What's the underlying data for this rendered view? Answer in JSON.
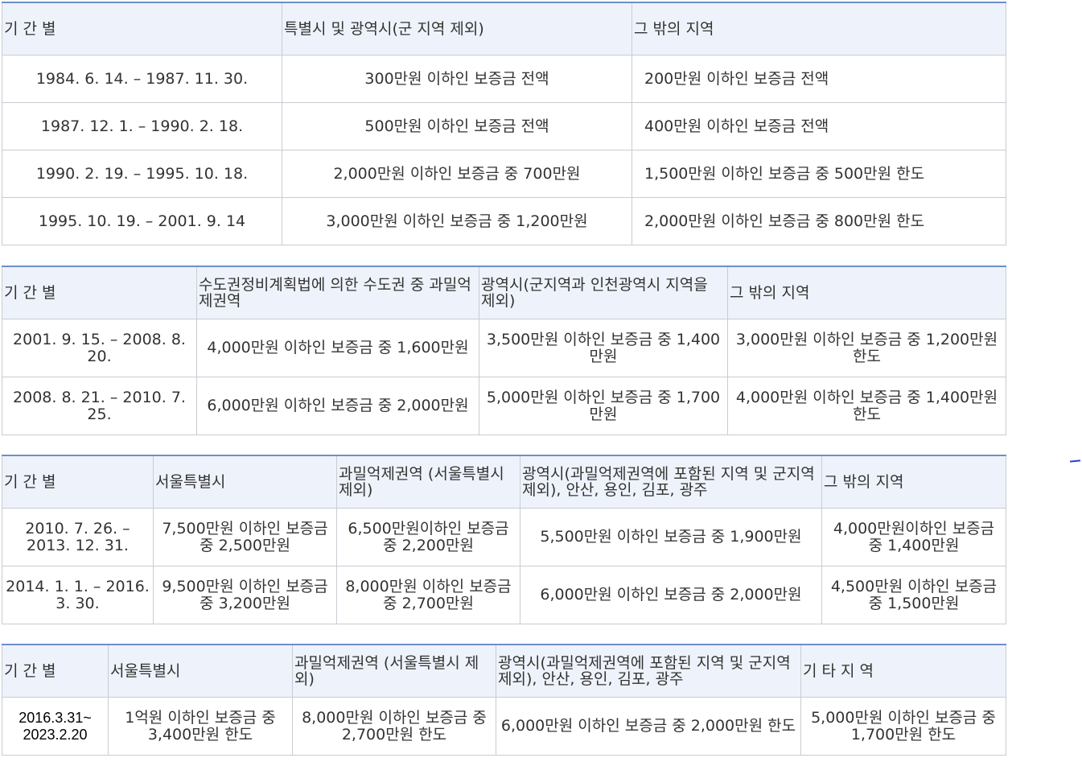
{
  "tables": [
    {
      "headers": [
        "기 간 별",
        "특별시 및 광역시(군 지역 제외)",
        "그 밖의 지역"
      ],
      "rows": [
        [
          "1984. 6. 14. – 1987. 11. 30.",
          "300만원 이하인 보증금 전액",
          "200만원 이하인 보증금 전액"
        ],
        [
          "1987. 12. 1. – 1990. 2. 18.",
          "500만원 이하인 보증금 전액",
          "400만원 이하인 보증금 전액"
        ],
        [
          "1990. 2. 19. – 1995. 10. 18.",
          "2,000만원 이하인 보증금 중 700만원",
          "1,500만원 이하인 보증금 중 500만원 한도"
        ],
        [
          "1995. 10. 19. – 2001. 9. 14",
          "3,000만원 이하인 보증금 중 1,200만원",
          "2,000만원 이하인 보증금 중 800만원 한도"
        ]
      ]
    },
    {
      "headers": [
        "기 간 별",
        "수도권정비계획법에 의한 수도권 중 과밀억제권역",
        "광역시(군지역과 인천광역시 지역을 제외)",
        "그 밖의 지역"
      ],
      "rows": [
        [
          "2001. 9. 15. – 2008. 8. 20.",
          "4,000만원 이하인 보증금 중 1,600만원",
          "3,500만원 이하인 보증금 중 1,400만원",
          "3,000만원 이하인 보증금 중 1,200만원 한도"
        ],
        [
          "2008. 8. 21. – 2010. 7. 25.",
          "6,000만원 이하인 보증금 중 2,000만원",
          "5,000만원 이하인 보증금 중 1,700만원",
          "4,000만원 이하인 보증금 중 1,400만원 한도"
        ]
      ]
    },
    {
      "headers": [
        "기 간 별",
        "서울특별시",
        "과밀억제권역 (서울특별시 제외)",
        "광역시(과밀억제권역에 포함된 지역 및 군지역 제외), 안산, 용인, 김포, 광주",
        "그 밖의 지역"
      ],
      "rows": [
        [
          "2010. 7. 26. – 2013. 12. 31.",
          "7,500만원 이하인 보증금 중 2,500만원",
          "6,500만원이하인 보증금 중 2,200만원",
          "5,500만원 이하인 보증금 중 1,900만원",
          "4,000만원이하인 보증금 중 1,400만원"
        ],
        [
          "2014. 1. 1. – 2016. 3. 30.",
          "9,500만원 이하인 보증금 중 3,200만원",
          "8,000만원 이하인 보증금 중 2,700만원",
          "6,000만원 이하인 보증금 중 2,000만원",
          "4,500만원 이하인 보증금 중 1,500만원"
        ]
      ]
    },
    {
      "headers": [
        "기 간 별",
        "서울특별시",
        "과밀억제권역 (서울특별시 제외)",
        "광역시(과밀억제권역에 포함된 지역 및 군지역 제외), 안산, 용인, 김포, 광주",
        "기 타 지 역"
      ],
      "rows": [
        [
          "2016.3.31~ 2023.2.20",
          "1억원 이하인 보증금 중 3,400만원 한도",
          "8,000만원 이하인 보증금 중 2,700만원 한도",
          "6,000만원 이하인 보증금 중 2,000만원 한도",
          "5,000만원 이하인 보증금 중 1,700만원 한도"
        ]
      ]
    }
  ]
}
